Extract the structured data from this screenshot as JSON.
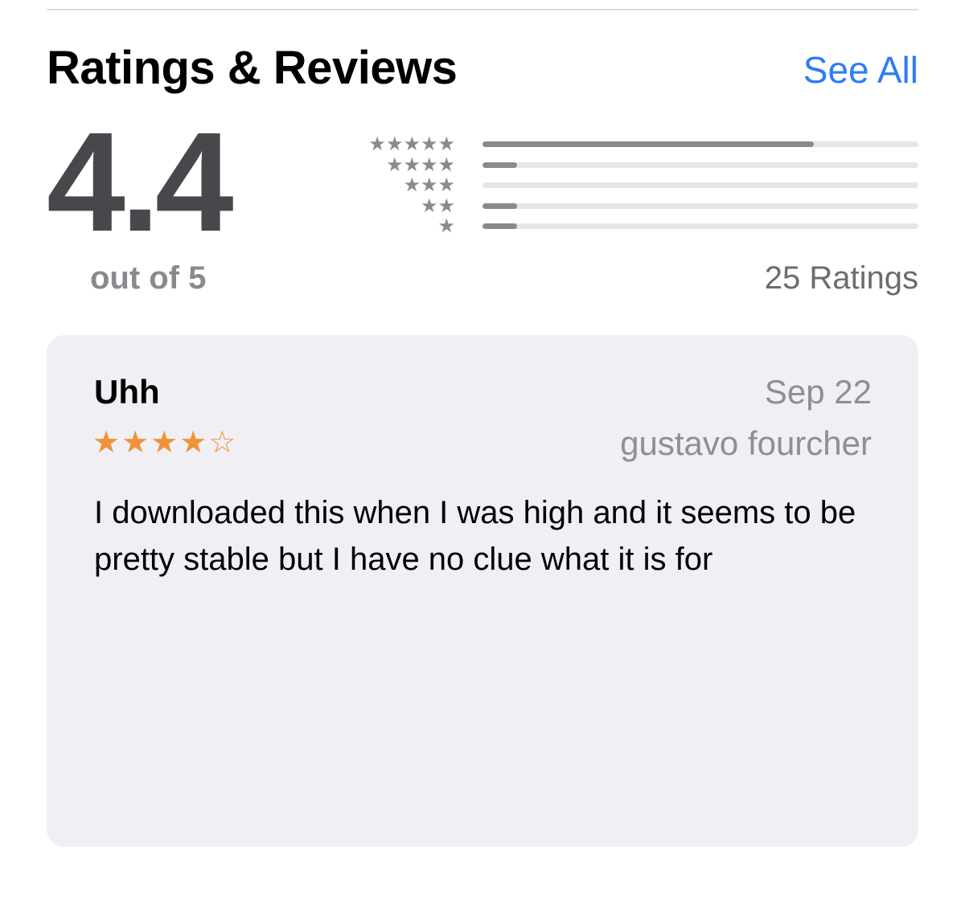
{
  "section": {
    "title": "Ratings & Reviews",
    "see_all_label": "See All"
  },
  "summary": {
    "average": "4.4",
    "out_of": "out of 5",
    "ratings_count": "25 Ratings"
  },
  "histogram": [
    {
      "stars": "★★★★★",
      "star_count": 5,
      "fraction": 0.76
    },
    {
      "stars": "★★★★",
      "star_count": 4,
      "fraction": 0.08
    },
    {
      "stars": "★★★",
      "star_count": 3,
      "fraction": 0.0
    },
    {
      "stars": "★★",
      "star_count": 2,
      "fraction": 0.08
    },
    {
      "stars": "★",
      "star_count": 1,
      "fraction": 0.08
    }
  ],
  "review": {
    "title": "Uhh",
    "date": "Sep 22",
    "author": "gustavo fourcher",
    "rating": 4,
    "rating_stars": "★★★★☆",
    "body": "I downloaded this when I was high and it seems to be pretty stable but I have no clue what it is for"
  },
  "colors": {
    "accent": "#2f7cf6",
    "star_orange": "#f0923a",
    "bar_fill": "#8a8a8e",
    "bar_track": "#e6e6ea",
    "card_background": "#efeff4"
  }
}
